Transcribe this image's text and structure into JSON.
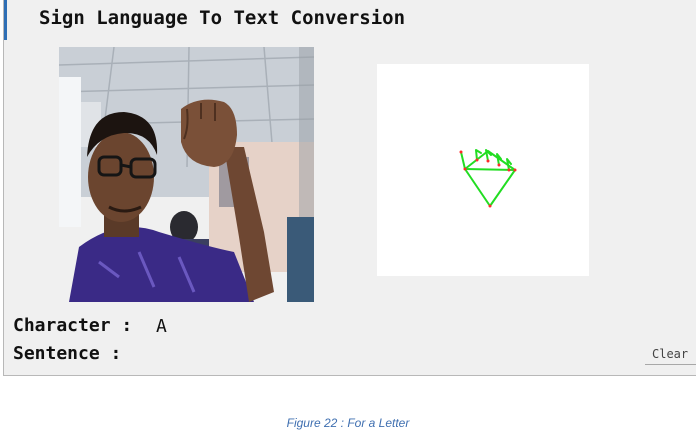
{
  "app": {
    "title": "Sign Language To Text Conversion",
    "character_label": "Character :",
    "character_value": "A",
    "sentence_label": "Sentence :",
    "sentence_value": "",
    "clear_button": "Clear"
  },
  "caption": "Figure 22 : For a Letter",
  "colors": {
    "skeleton": "#22dd22",
    "caption": "#3f6fb0",
    "window_bg": "#f0f0f0"
  }
}
